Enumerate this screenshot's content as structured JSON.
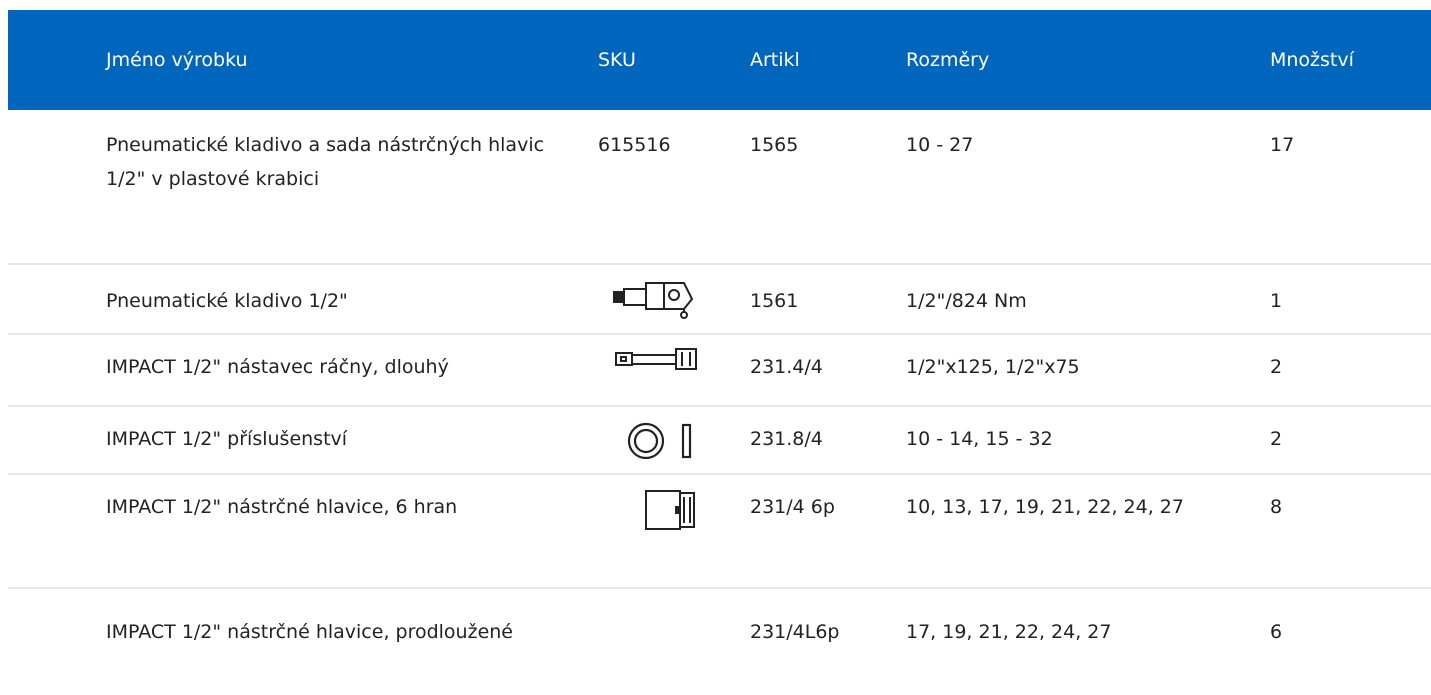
{
  "header": {
    "name": "Jméno výrobku",
    "sku": "SKU",
    "article": "Artikl",
    "dimensions": "Rozměry",
    "quantity": "Množství"
  },
  "colors": {
    "header_bg": "#0066bd",
    "header_text": "#ffffff",
    "divider": "#e6e6e6",
    "text": "#222222"
  },
  "rows": [
    {
      "name": "Pneumatické kladivo a sada nástrčných hlavic 1/2\" v plastové krabici",
      "sku": "615516",
      "sku_icon": "",
      "article": "1565",
      "dimensions": "10 - 27",
      "quantity": "17"
    },
    {
      "name": "Pneumatické kladivo 1/2\"",
      "sku": "",
      "sku_icon": "impact-wrench-icon",
      "article": "1561",
      "dimensions": "1/2\"/824 Nm",
      "quantity": "1"
    },
    {
      "name": "IMPACT 1/2\" nástavec ráčny, dlouhý",
      "sku": "",
      "sku_icon": "extension-bar-icon",
      "article": "231.4/4",
      "dimensions": "1/2\"x125, 1/2\"x75",
      "quantity": "2"
    },
    {
      "name": "IMPACT 1/2\" příslušenství",
      "sku": "",
      "sku_icon": "ring-and-pin-icon",
      "article": "231.8/4",
      "dimensions": "10 - 14, 15 - 32",
      "quantity": "2"
    },
    {
      "name": "IMPACT 1/2\" nástrčné hlavice, 6 hran",
      "sku": "",
      "sku_icon": "socket-icon",
      "article": "231/4 6p",
      "dimensions": "10, 13, 17, 19, 21, 22, 24, 27",
      "quantity": "8"
    },
    {
      "name": "IMPACT 1/2\" nástrčné hlavice, prodloužené",
      "sku": "",
      "sku_icon": "",
      "article": "231/4L6p",
      "dimensions": "17, 19, 21, 22, 24, 27",
      "quantity": "6"
    }
  ]
}
